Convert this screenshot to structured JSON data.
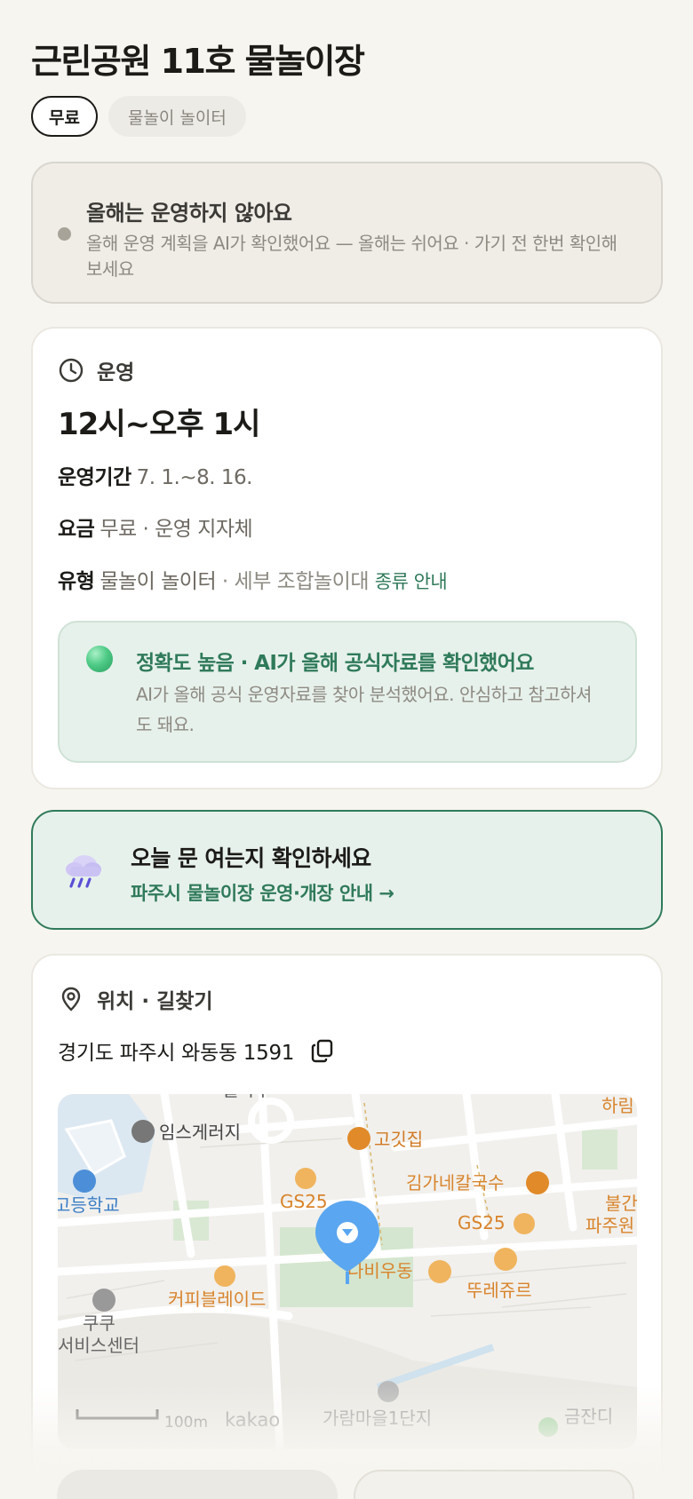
{
  "header": {
    "title": "근린공원 11호 물놀이장",
    "chips": [
      "무료",
      "물놀이 놀이터"
    ]
  },
  "notice": {
    "title": "올해는 운영하지 않아요",
    "description": "올해 운영 계획을 AI가 확인했어요 — 올해는 쉬어요 · 가기 전 한번 확인해보세요"
  },
  "operation": {
    "section_label": "운영",
    "hours": "12시~오후 1시",
    "period_label": "운영기간",
    "period_value": "7. 1.~8. 16.",
    "fee_label": "요금",
    "fee_value": "무료 · 운영 지자체",
    "type_label": "유형",
    "type_value": "물놀이 놀이터",
    "type_detail": " · 세부 조합놀이대",
    "type_link": "종류 안내",
    "accuracy_title": "정확도 높음 · AI가 올해 공식자료를 확인했어요",
    "accuracy_desc": "AI가 올해 공식 운영자료를 찾아 분석했어요. 안심하고 참고하셔도 돼요."
  },
  "weather": {
    "title": "오늘 문 여는지 확인하세요",
    "link": "파주시 물놀이장 운영·개장 안내 →"
  },
  "location": {
    "section_label": "위치 · 길찾기",
    "address": "경기도 파주시 와동동 1591"
  },
  "map": {
    "labels": {
      "top_partial": "월하우",
      "top_right_partial": "하림",
      "imsgeriji": "임스게러지",
      "gogitjip": "고깃집",
      "school": "고등학교",
      "gimga": "김가네칼국수",
      "gs25a": "GS25",
      "gs25b": "GS25",
      "bulgeun": "불간",
      "paju": "파주원",
      "nabiudong": "나비우동",
      "coffee": "커피블레이드",
      "tlejure": "뚜레쥬르",
      "kuku": "쿠쿠",
      "service": "서비스센터",
      "garam": "가람마을1단지",
      "geumjandi": "금잔디",
      "scale": "100m",
      "brand": "kakao"
    }
  },
  "colors": {
    "accent_green": "#2f7a5a",
    "map_pin": "#5aa6f0",
    "poi_orange": "#e08a2a"
  }
}
